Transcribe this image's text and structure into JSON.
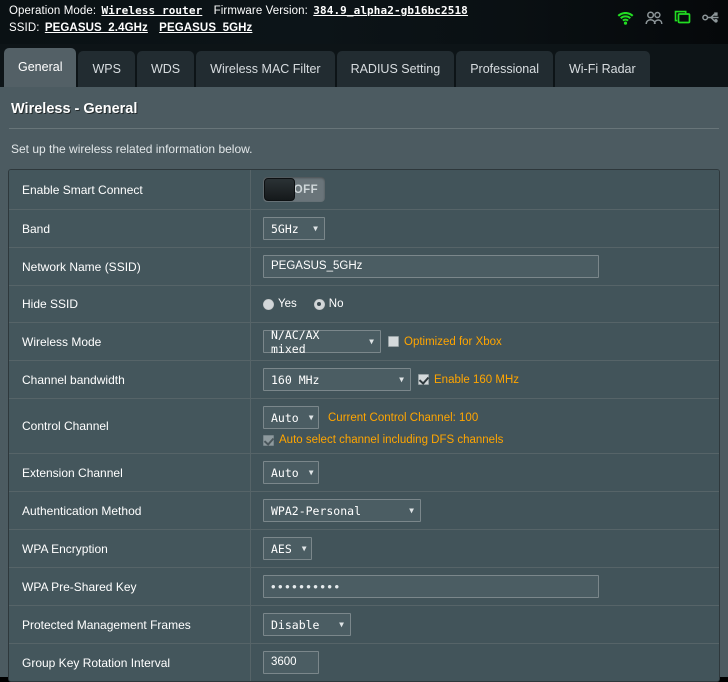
{
  "statusbar": {
    "operation_mode_label": "Operation Mode:",
    "operation_mode_value": "Wireless router",
    "firmware_label": "Firmware Version:",
    "firmware_value": "384.9_alpha2-gb16bc2518",
    "ssid_label": "SSID:",
    "ssid_1": "PEGASUS_2.4GHz",
    "ssid_2": "PEGASUS_5GHz",
    "icons": [
      {
        "name": "wifi-icon",
        "color": "#22dd22"
      },
      {
        "name": "users-icon",
        "color": "#8d9699"
      },
      {
        "name": "monitor-icon",
        "color": "#22dd22"
      },
      {
        "name": "usb-icon",
        "color": "#8d9699"
      }
    ]
  },
  "tabs": [
    {
      "label": "General",
      "active": true
    },
    {
      "label": "WPS",
      "active": false
    },
    {
      "label": "WDS",
      "active": false
    },
    {
      "label": "Wireless MAC Filter",
      "active": false
    },
    {
      "label": "RADIUS Setting",
      "active": false
    },
    {
      "label": "Professional",
      "active": false
    },
    {
      "label": "Wi-Fi Radar",
      "active": false
    }
  ],
  "page": {
    "title": "Wireless - General",
    "description": "Set up the wireless related information below."
  },
  "form": {
    "smart_connect": {
      "label": "Enable Smart Connect",
      "toggle_state": "OFF"
    },
    "band": {
      "label": "Band",
      "value": "5GHz"
    },
    "ssid": {
      "label": "Network Name (SSID)",
      "value": "PEGASUS_5GHz"
    },
    "hide_ssid": {
      "label": "Hide SSID",
      "option_yes": "Yes",
      "option_no": "No",
      "selected": "No"
    },
    "wireless_mode": {
      "label": "Wireless Mode",
      "value": "N/AC/AX mixed",
      "xbox_label": "Optimized for Xbox",
      "xbox_checked": false
    },
    "channel_bandwidth": {
      "label": "Channel bandwidth",
      "value": "160 MHz",
      "enable_160_label": "Enable 160 MHz",
      "enable_160_checked": true
    },
    "control_channel": {
      "label": "Control Channel",
      "value": "Auto",
      "current_channel_note": "Current Control Channel: 100",
      "dfs_label": "Auto select channel including DFS channels",
      "dfs_checked": true
    },
    "extension_channel": {
      "label": "Extension Channel",
      "value": "Auto"
    },
    "authentication_method": {
      "label": "Authentication Method",
      "value": "WPA2-Personal"
    },
    "wpa_encryption": {
      "label": "WPA Encryption",
      "value": "AES"
    },
    "wpa_psk": {
      "label": "WPA Pre-Shared Key",
      "value": "••••••••••"
    },
    "pmf": {
      "label": "Protected Management Frames",
      "value": "Disable"
    },
    "group_key_rotation": {
      "label": "Group Key Rotation Interval",
      "value": "3600"
    }
  },
  "colors": {
    "accent_orange": "#ffa500",
    "panel_bg": "#4c5b61",
    "row_bg": "#42545a",
    "active_tab": "#536066",
    "status_green": "#22dd22"
  }
}
